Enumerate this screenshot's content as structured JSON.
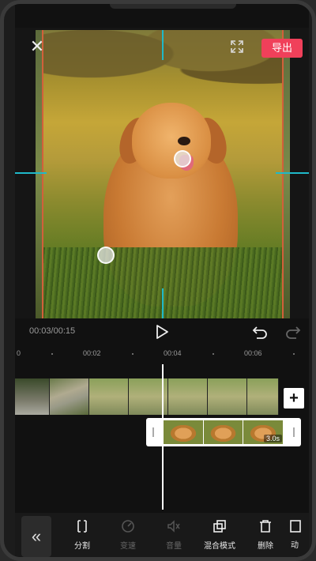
{
  "editor": {
    "export_label": "导出",
    "close_icon": "close-icon",
    "fullscreen_icon": "fullscreen-icon"
  },
  "playback": {
    "time": "00:03/00:15"
  },
  "timeline": {
    "ruler_labels": [
      "0",
      "00:02",
      "00:04",
      "00:06"
    ],
    "overlay_duration": "3.0s",
    "add_icon_text": "+"
  },
  "toolbar": {
    "collapse_icon": "«",
    "items": [
      {
        "label": "分割",
        "icon": "split-icon",
        "enabled": true
      },
      {
        "label": "变速",
        "icon": "speed-icon",
        "enabled": false
      },
      {
        "label": "音量",
        "icon": "volume-icon",
        "enabled": false
      },
      {
        "label": "混合模式",
        "icon": "blend-mode-icon",
        "enabled": true
      },
      {
        "label": "删除",
        "icon": "delete-icon",
        "enabled": true
      },
      {
        "label": "动",
        "icon": "animation-icon",
        "enabled": true
      }
    ]
  },
  "colors": {
    "accent": "#f0405a",
    "guide": "#1fb9c9",
    "clip_border": "#d2603a"
  }
}
